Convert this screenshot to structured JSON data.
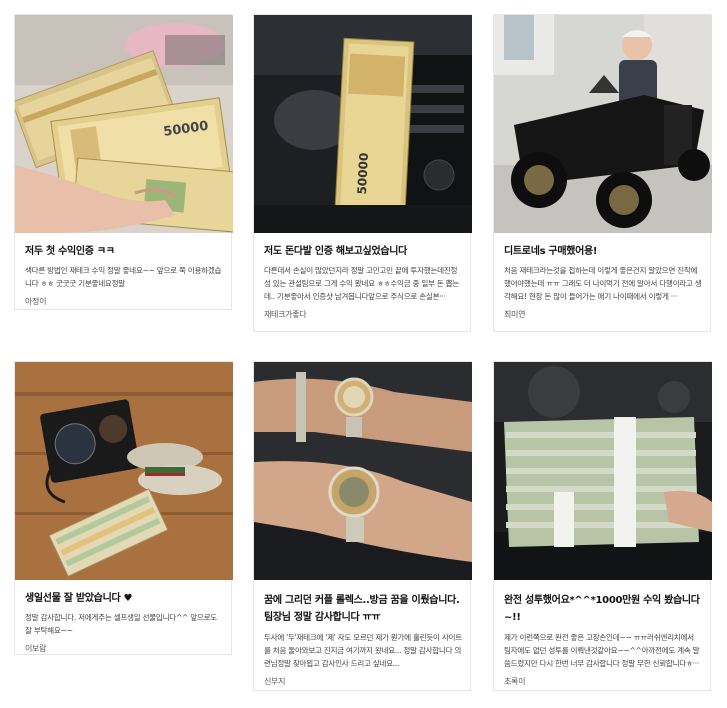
{
  "posts": [
    {
      "image": "hands holding bundles of 50000 won bills",
      "title": "저두 첫 수익인증 ㅋㅋ",
      "excerpt": "색다른 방법인 재테크 수익 정말 좋네요~~ 앞으로 쭉 이용하겠습니다 ㅎㅎ 굿굿굿 기분좋네요정말",
      "author": "아정이"
    },
    {
      "image": "stack of 50000 won bills clipped to car air vent",
      "title": "저도 돈다발 인증 해보고싶었습니다",
      "excerpt": "다른데서 손실이 많았던지라 정말 고민고민 끝에 투자했는데진정성 있는 관설팀으로 그게 수익 봤네요 ㅎㅎ수익금 중 일부 돈 뽑는데.. 기분좋아서 인증샷 남겨봅니다앞으로 주식으로 손실본···",
      "author": "재테크가좋다"
    },
    {
      "image": "child sitting in a small black vintage electric car",
      "title": "디트로네s 구매했어용!",
      "excerpt": "처음 재테크라는것을 접하는데 이렇게 좋은건지 알았으면 진작에 했어야했는데 ㅠㅠ 그래도 더 나이먹기 전에 알아서 다행이라고 생각해요! 현장 돈 많이 들어가는 애기 나이때에서 이렇게 ···",
      "author": "최미연"
    },
    {
      "image": "gucci wallet, sneakers and fan of won bills on wooden floor",
      "title": "생일선물 잘 받았습니다 ♥",
      "excerpt": "정말 감사합니다. 저에게주는 셀프생일 선물입니다^^ 앞으로도 잘 부탁해요~~",
      "author": "이보람"
    },
    {
      "image": "two wrists wearing gold and silver rolex watches",
      "title": "꿈에 그리던 커플 롤렉스..방금 꿈을 이뤘습니다.팀장님 정말 감사합니다 ㅠㅠ",
      "excerpt": "두사에 '두'재테크에 '제' 자도 모르던 제가 뭔가에 홀린듯이 사이트를 처음 둘아와보고 진지금 여기까지 왔네요... 정말 감사합니다 의련님정말 찾아뵙고 감사인사 드리고 싶네요...",
      "author": "신부지"
    },
    {
      "image": "hand holding large stack of won bills in car",
      "title": "완전 성투했어요*^^*1000만원 수익 봤습니다~!!",
      "excerpt": "제가 이런쪽으로 완전 좋은 고장손인데~~ ㅠㅠ러쉬엔리치에서 팀자에도 없던 성투를 이뤄낸것같아요~~^^아까전에도 계속 말씀드렸지만 다시 한번 너무 감사합니다 정말 무한 신뢰합니다ㅎ···",
      "author": "초록이"
    }
  ],
  "money_label": "50000"
}
